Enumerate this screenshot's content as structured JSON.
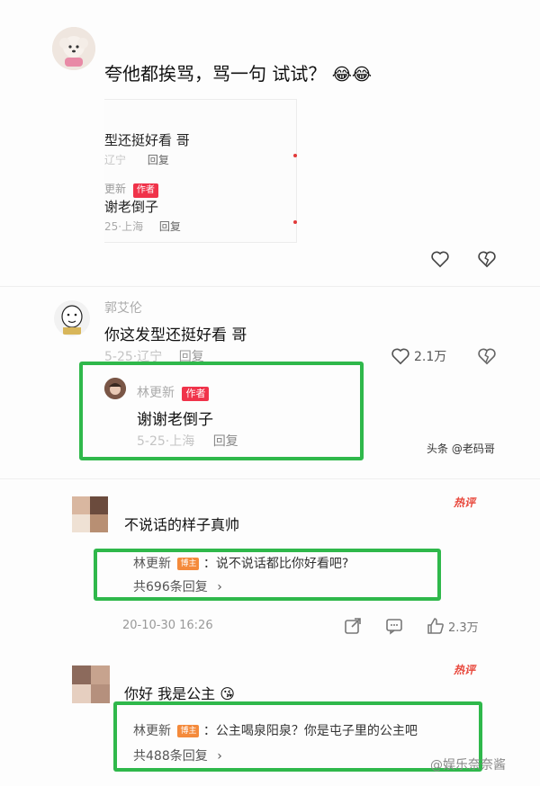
{
  "section1": {
    "title": "夸他都挨骂，骂一句 试试？",
    "emojis": "😂😂",
    "inset": {
      "comment_text": "型还挺好看 哥",
      "meta_location": "辽宁",
      "reply_label": "回复",
      "author_name": "更新",
      "author_tag": "作者",
      "author_text": "谢老倒子",
      "author_meta": "25·上海",
      "author_reply": "回复"
    }
  },
  "section2": {
    "username": "郭艾伦",
    "comment": "你这发型还挺好看 哥",
    "meta": "5-25·辽宁",
    "reply_label": "回复",
    "likes": "2.1万",
    "reply": {
      "username": "林更新",
      "tag": "作者",
      "text": "谢谢老倒子",
      "meta": "5-25·上海",
      "reply_label": "回复"
    },
    "watermark": "头条 @老码哥"
  },
  "section3": {
    "hot_badge": "热评",
    "comment": "不说话的样子真帅",
    "reply": {
      "username": "林更新",
      "tag": "博主",
      "text": "：说不说话都比你好看吧?",
      "more": "共696条回复"
    },
    "timestamp": "20-10-30 16:26",
    "likes": "2.3万"
  },
  "section4": {
    "hot_badge": "热评",
    "comment": "你好 我是公主",
    "emoji": "😘",
    "reply": {
      "username": "林更新",
      "tag": "博主",
      "text": "：公主喝泉阳泉？你是屯子里的公主吧",
      "more": "共488条回复"
    },
    "watermark": "@娱乐奈奈酱"
  },
  "colors": {
    "highlight": "#2fb84b",
    "author_tag": "#f0334a",
    "blogger_tag": "#f48a3b",
    "hot": "#e8463a"
  }
}
